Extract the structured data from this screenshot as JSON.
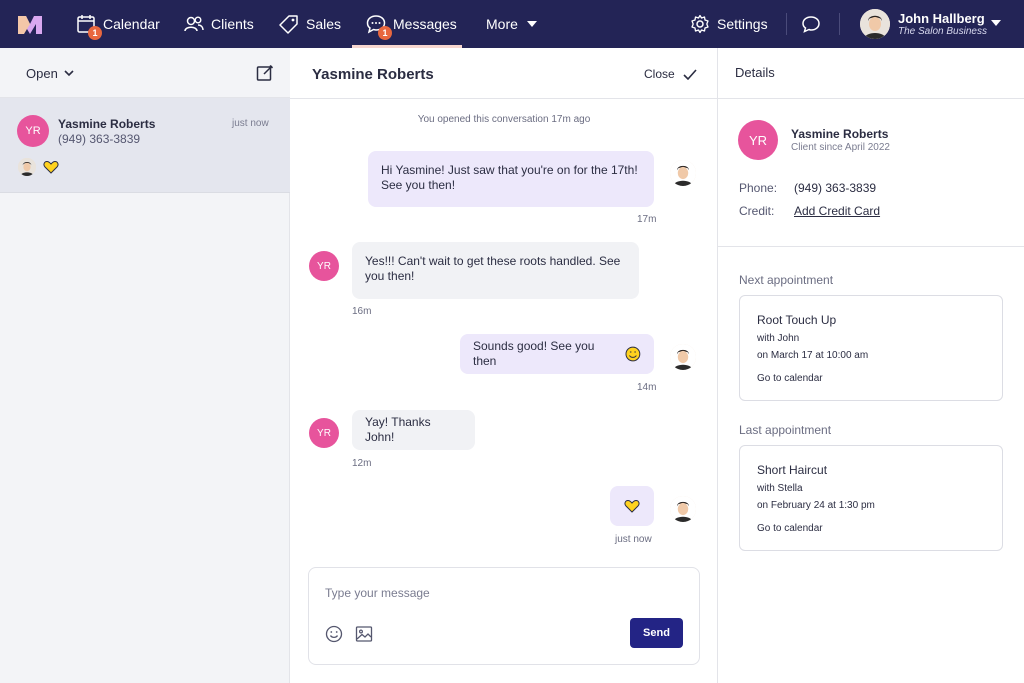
{
  "nav": {
    "items": [
      {
        "label": "Calendar",
        "badge": "1",
        "icon": "calendar-icon"
      },
      {
        "label": "Clients",
        "icon": "clients-icon"
      },
      {
        "label": "Sales",
        "icon": "tag-icon"
      },
      {
        "label": "Messages",
        "badge": "1",
        "icon": "chat-bubble-icon",
        "active": true
      },
      {
        "label": "More",
        "icon": "caret-down-icon"
      }
    ],
    "settings_label": "Settings",
    "user": {
      "name": "John Hallberg",
      "business": "The Salon Business"
    }
  },
  "colors": {
    "nav_bg": "#232456",
    "badge": "#e8673f",
    "avatar": "#e7549c",
    "send": "#232485",
    "outgoing_bubble": "#ede8fb",
    "incoming_bubble": "#f1f2f5"
  },
  "inbox": {
    "filter_label": "Open",
    "conversation": {
      "initials": "YR",
      "name": "Yasmine Roberts",
      "phone": "(949) 363-3839",
      "time": "just now"
    }
  },
  "conversation": {
    "title": "Yasmine Roberts",
    "close_label": "Close",
    "system_note": "You opened this conversation 17m ago",
    "messages": [
      {
        "text": "Hi Yasmine! Just saw that you're on for the 17th! See you then!",
        "time": "17m"
      },
      {
        "text": "Yes!!! Can't wait to get these roots handled. See you then!",
        "time": "16m",
        "initials": "YR"
      },
      {
        "text": "Sounds good! See you then",
        "time": "14m"
      },
      {
        "text": "Yay! Thanks John!",
        "time": "12m",
        "initials": "YR"
      },
      {
        "time": "just now"
      }
    ],
    "composer": {
      "placeholder": "Type your message",
      "send_label": "Send"
    }
  },
  "details": {
    "title": "Details",
    "client": {
      "initials": "YR",
      "name": "Yasmine Roberts",
      "since": "Client since April 2022",
      "phone_label": "Phone:",
      "phone": "(949) 363-3839",
      "credit_label": "Credit:",
      "credit_link": "Add Credit Card"
    },
    "next": {
      "label": "Next appointment",
      "service": "Root Touch Up",
      "with": "with John",
      "when": "on March 17 at 10:00 am",
      "link": "Go to calendar"
    },
    "last": {
      "label": "Last appointment",
      "service": "Short Haircut",
      "with": "with Stella",
      "when": "on February 24 at 1:30 pm",
      "link": "Go to calendar"
    }
  }
}
